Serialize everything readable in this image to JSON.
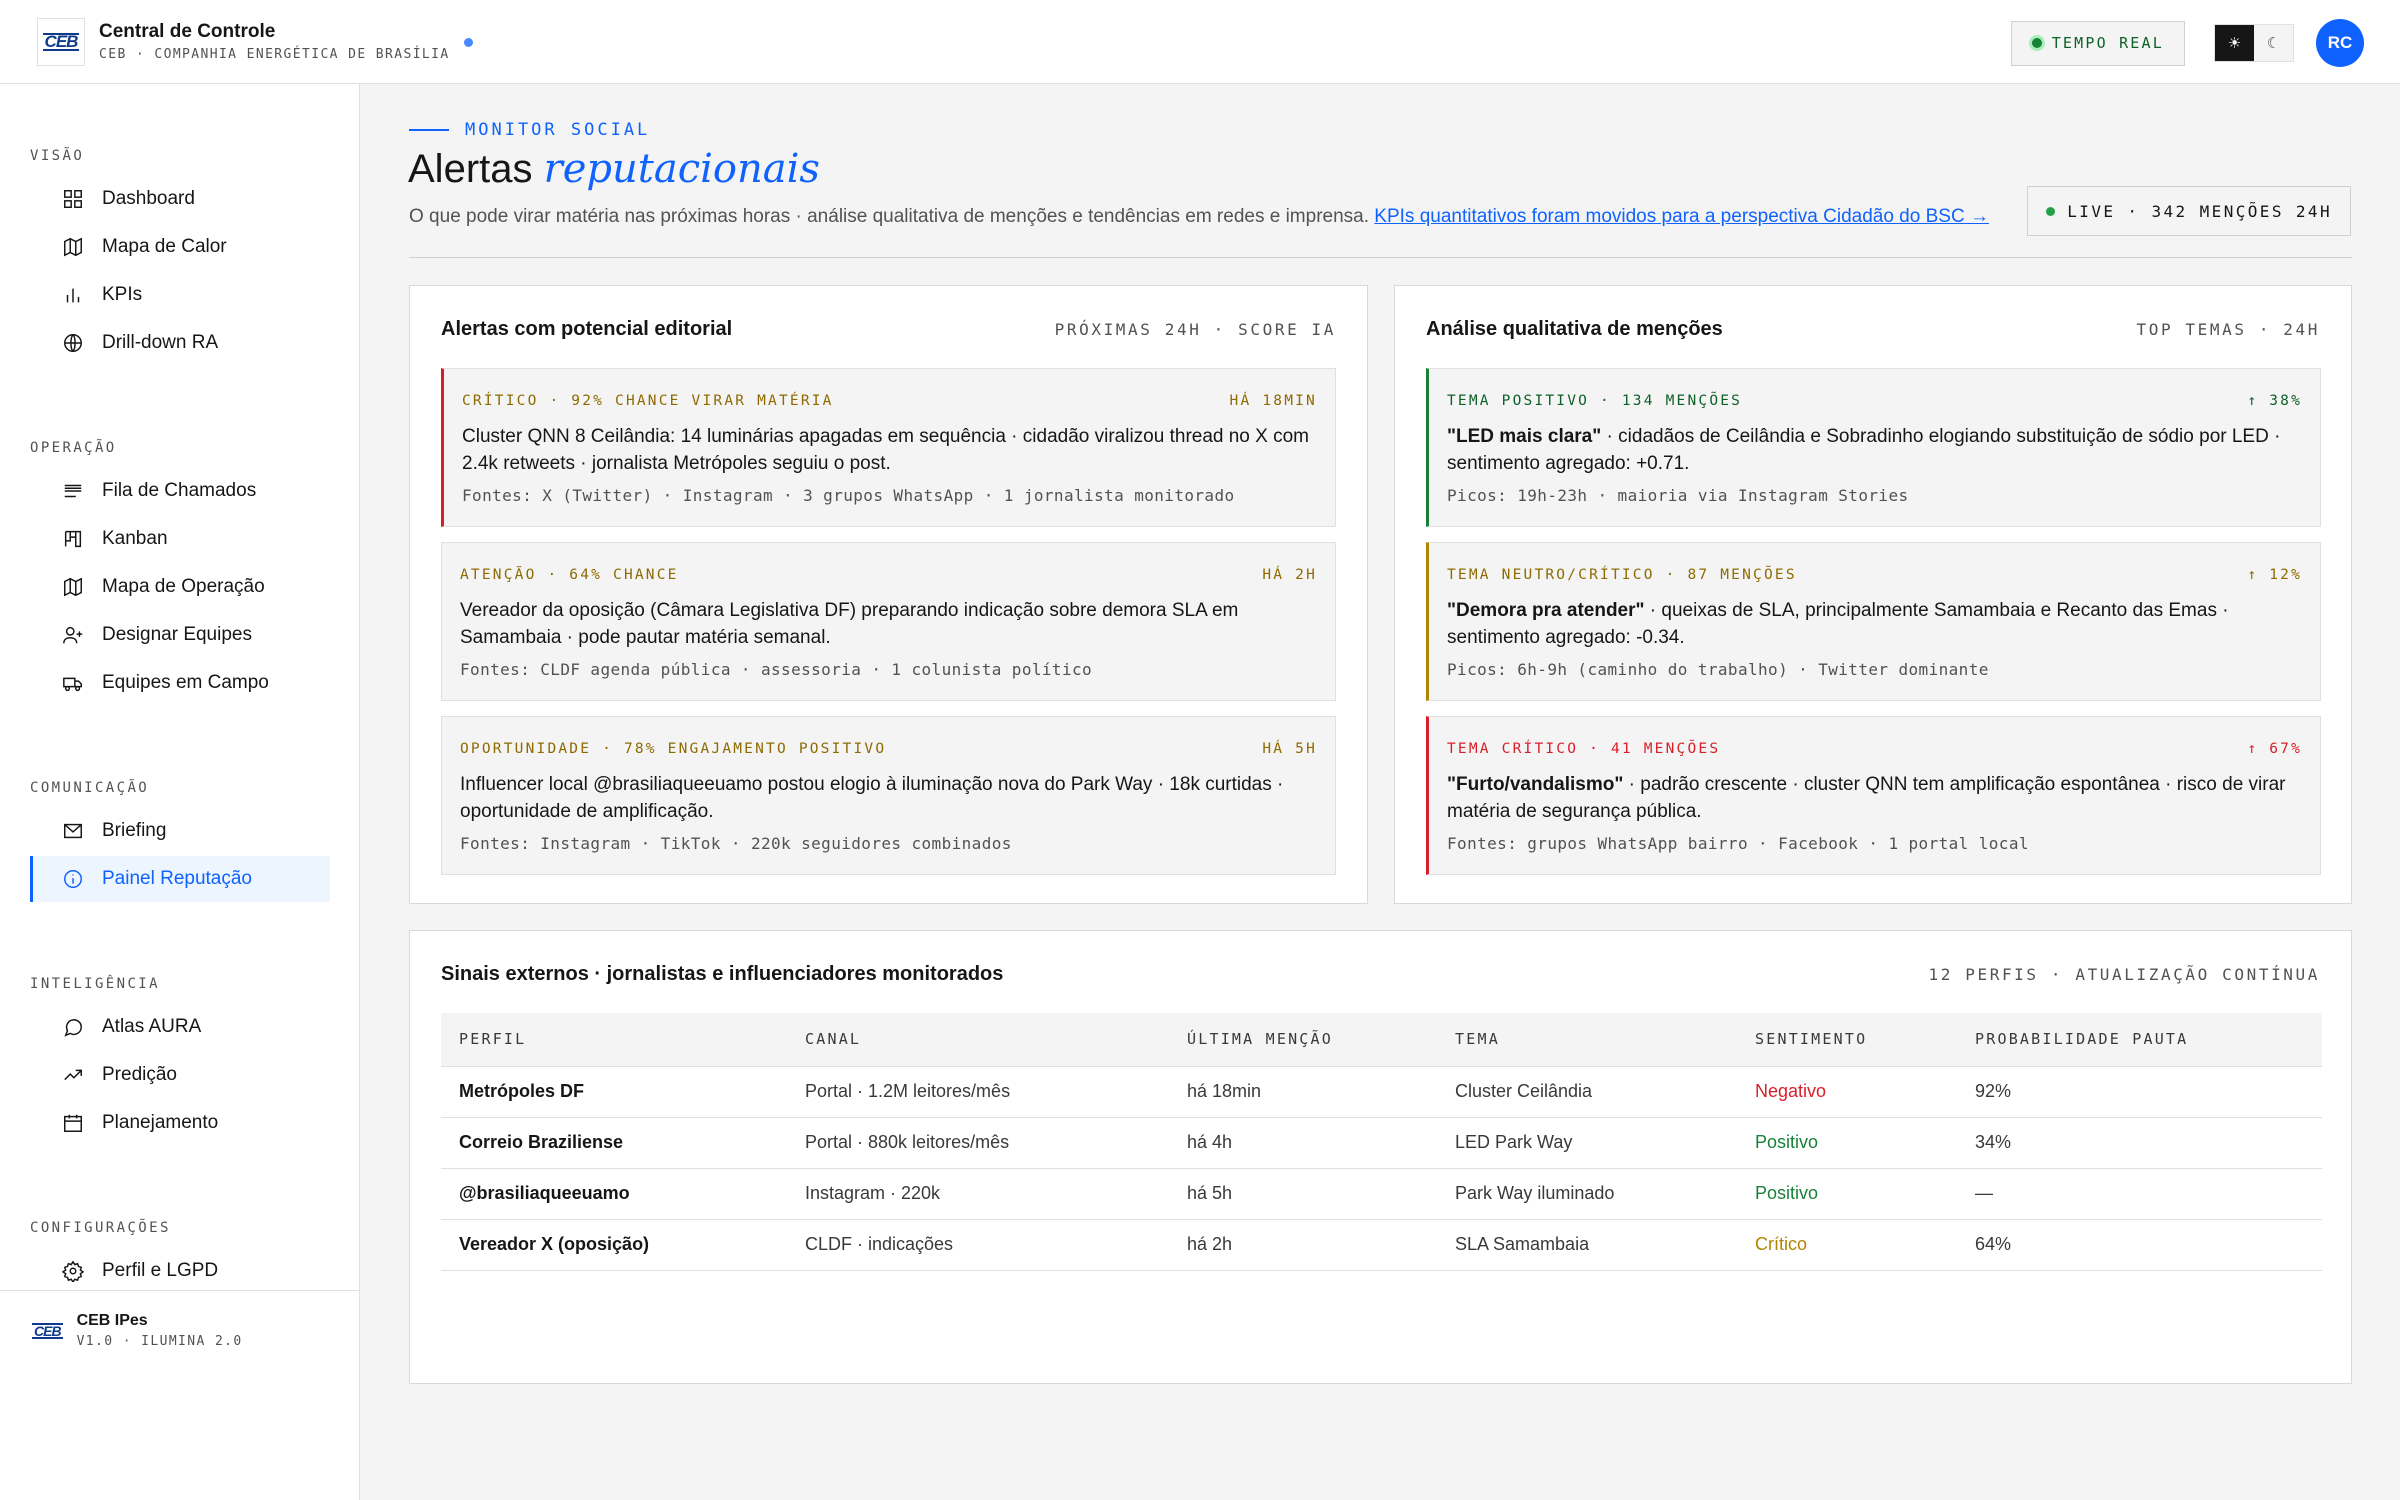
{
  "header": {
    "logo": "CEB",
    "title": "Central de Controle",
    "subtitle": "CEB · COMPANHIA ENERGÉTICA DE BRASÍLIA",
    "tempo_real": "TEMPO REAL",
    "theme_light_glyph": "☀",
    "theme_dark_glyph": "☾",
    "avatar_initials": "RC"
  },
  "sidebar": {
    "sections": [
      {
        "title": "VISÃO",
        "items": [
          {
            "label": "Dashboard",
            "icon": "grid-icon"
          },
          {
            "label": "Mapa de Calor",
            "icon": "map-icon"
          },
          {
            "label": "KPIs",
            "icon": "bar-chart-icon"
          },
          {
            "label": "Drill-down RA",
            "icon": "globe-icon"
          }
        ]
      },
      {
        "title": "OPERAÇÃO",
        "items": [
          {
            "label": "Fila de Chamados",
            "icon": "list-icon"
          },
          {
            "label": "Kanban",
            "icon": "kanban-icon"
          },
          {
            "label": "Mapa de Operação",
            "icon": "map-icon"
          },
          {
            "label": "Designar Equipes",
            "icon": "user-add-icon"
          },
          {
            "label": "Equipes em Campo",
            "icon": "truck-icon"
          }
        ]
      },
      {
        "title": "COMUNICAÇÃO",
        "items": [
          {
            "label": "Briefing",
            "icon": "mail-icon"
          },
          {
            "label": "Painel Reputação",
            "icon": "info-icon",
            "active": true
          }
        ]
      },
      {
        "title": "INTELIGÊNCIA",
        "items": [
          {
            "label": "Atlas AURA",
            "icon": "chat-icon"
          },
          {
            "label": "Predição",
            "icon": "trend-icon"
          },
          {
            "label": "Planejamento",
            "icon": "calendar-icon"
          }
        ]
      },
      {
        "title": "CONFIGURAÇÕES",
        "items": [
          {
            "label": "Perfil e LGPD",
            "icon": "gear-icon"
          }
        ]
      }
    ],
    "footer": {
      "logo": "CEB",
      "name": "CEB IPes",
      "version": "V1.0 · ILUMINA 2.0"
    }
  },
  "page": {
    "eyebrow": "MONITOR SOCIAL",
    "title_plain": "Alertas",
    "title_italic": "reputacionais",
    "subtitle": "O que pode virar matéria nas próximas horas · análise qualitativa de menções e tendências em redes e imprensa.",
    "subtitle_link": "KPIs quantitativos foram movidos para a perspectiva Cidadão do BSC →",
    "live": "LIVE · 342 MENÇÕES 24H"
  },
  "alerts_card": {
    "title": "Alertas com potencial editorial",
    "meta": "PRÓXIMAS 24H · SCORE IA",
    "items": [
      {
        "tag": "CRÍTICO · 92% CHANCE VIRAR MATÉRIA",
        "time": "HÁ 18MIN",
        "body": "Cluster QNN 8 Ceilândia: 14 luminárias apagadas em sequência · cidadão viralizou thread no X com 2.4k retweets · jornalista Metrópoles seguiu o post.",
        "sources": "Fontes: X (Twitter) · Instagram · 3 grupos WhatsApp · 1 jornalista monitorado",
        "color": "#8e6a00"
      },
      {
        "tag": "ATENÇÃO · 64% CHANCE",
        "time": "HÁ 2H",
        "body": "Vereador da oposição (Câmara Legislativa DF) preparando indicação sobre demora SLA em Samambaia · pode pautar matéria semanal.",
        "sources": "Fontes: CLDF agenda pública · assessoria · 1 colunista político",
        "color": "#8e6a00"
      },
      {
        "tag": "OPORTUNIDADE · 78% ENGAJAMENTO POSITIVO",
        "time": "HÁ 5H",
        "body": "Influencer local @brasiliaqueeuamo postou elogio à iluminação nova do Park Way · 18k curtidas · oportunidade de amplificação.",
        "sources": "Fontes: Instagram · TikTok · 220k seguidores combinados",
        "color": "#8e6a00"
      }
    ]
  },
  "mentions_card": {
    "title": "Análise qualitativa de menções",
    "meta": "TOP TEMAS · 24H",
    "items": [
      {
        "tag": "TEMA POSITIVO · 134 MENÇÕES",
        "time": "↑ 38%",
        "quote": "\"LED mais clara\"",
        "body": " · cidadãos de Ceilândia e Sobradinho elogiando substituição de sódio por LED · sentimento agregado: +0.71.",
        "sources": "Picos: 19h-23h · maioria via Instagram Stories",
        "color": "#0e6027"
      },
      {
        "tag": "TEMA NEUTRO/CRÍTICO · 87 MENÇÕES",
        "time": "↑ 12%",
        "quote": "\"Demora pra atender\"",
        "body": " · queixas de SLA, principalmente Samambaia e Recanto das Emas · sentimento agregado: -0.34.",
        "sources": "Picos: 6h-9h (caminho do trabalho) · Twitter dominante",
        "color": "#8e6a00"
      },
      {
        "tag": "TEMA CRÍTICO · 41 MENÇÕES",
        "time": "↑ 67%",
        "quote": "\"Furto/vandalismo\"",
        "body": " · padrão crescente · cluster QNN tem amplificação espontânea · risco de virar matéria de segurança pública.",
        "sources": "Fontes: grupos WhatsApp bairro · Facebook · 1 portal local",
        "color": "#da1e28"
      }
    ]
  },
  "signals_card": {
    "title": "Sinais externos · jornalistas e influenciadores monitorados",
    "meta": "12 PERFIS · ATUALIZAÇÃO CONTÍNUA",
    "columns": [
      "PERFIL",
      "CANAL",
      "ÚLTIMA MENÇÃO",
      "TEMA",
      "SENTIMENTO",
      "PROBABILIDADE PAUTA"
    ],
    "rows": [
      {
        "perfil": "Metrópoles DF",
        "canal": "Portal · 1.2M leitores/mês",
        "ultima": "há 18min",
        "tema": "Cluster Ceilândia",
        "sentimento": "Negativo",
        "sent_color": "#da1e28",
        "prob": "92%"
      },
      {
        "perfil": "Correio Braziliense",
        "canal": "Portal · 880k leitores/mês",
        "ultima": "há 4h",
        "tema": "LED Park Way",
        "sentimento": "Positivo",
        "sent_color": "#198038",
        "prob": "34%"
      },
      {
        "perfil": "@brasiliaqueeuamo",
        "canal": "Instagram · 220k",
        "ultima": "há 5h",
        "tema": "Park Way iluminado",
        "sentimento": "Positivo",
        "sent_color": "#198038",
        "prob": "—"
      },
      {
        "perfil": "Vereador X (oposição)",
        "canal": "CLDF · indicações",
        "ultima": "há 2h",
        "tema": "SLA Samambaia",
        "sentimento": "Crítico",
        "sent_color": "#b28600",
        "prob": "64%"
      }
    ]
  },
  "colors": {
    "accent": "#0f62fe",
    "critical": "#da1e28",
    "warning": "#b28600",
    "positive": "#198038"
  }
}
